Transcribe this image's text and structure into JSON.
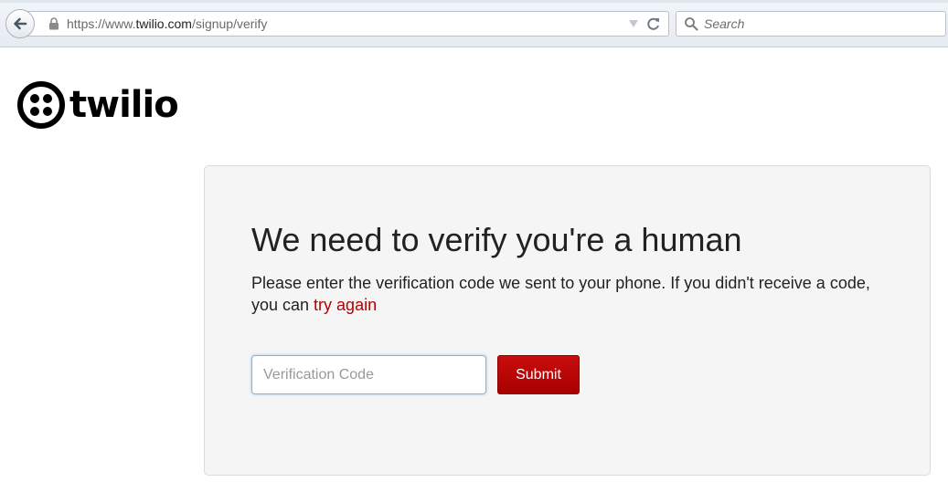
{
  "browser": {
    "url_prefix": "https://www.",
    "url_host": "twilio.com",
    "url_path": "/signup/verify",
    "search_placeholder": "Search"
  },
  "logo": {
    "wordmark": "twilio"
  },
  "verify": {
    "title": "We need to verify you're a human",
    "instructions_text": "Please enter the verification code we sent to your phone. If you didn't receive a code, you can ",
    "try_again_label": "try again",
    "code_placeholder": "Verification Code",
    "code_value": "",
    "submit_label": "Submit"
  },
  "colors": {
    "brand_red": "#b30000",
    "panel_background": "#f5f5f5"
  }
}
